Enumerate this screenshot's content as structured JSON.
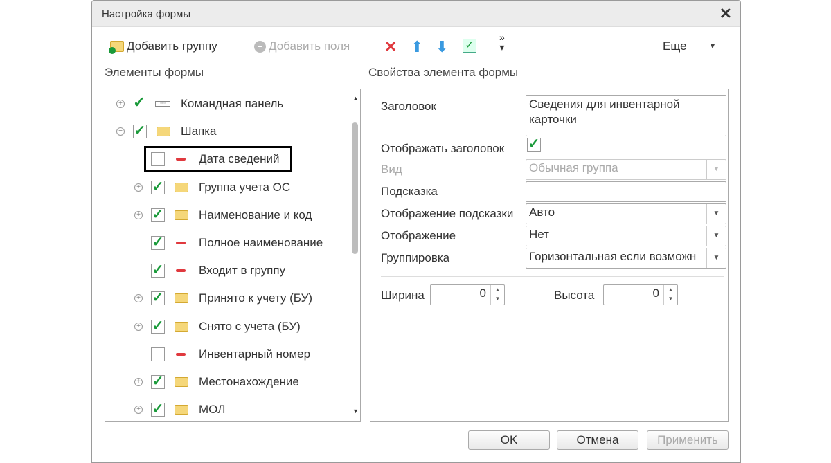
{
  "window": {
    "title": "Настройка формы"
  },
  "toolbar": {
    "add_group": "Добавить группу",
    "add_fields": "Добавить поля",
    "more": "Еще"
  },
  "left": {
    "header": "Элементы формы",
    "items": [
      {
        "label": "Командная панель",
        "level": 0,
        "expander": "+",
        "check": "plain",
        "icon": "command-panel"
      },
      {
        "label": "Шапка",
        "level": 0,
        "expander": "-",
        "check": "checked",
        "icon": "folder"
      },
      {
        "label": "Дата сведений",
        "level": 1,
        "expander": "",
        "check": "unchecked",
        "icon": "field",
        "selected": true
      },
      {
        "label": "Группа учета ОС",
        "level": 1,
        "expander": "+",
        "check": "checked",
        "icon": "folder"
      },
      {
        "label": "Наименование и код",
        "level": 1,
        "expander": "+",
        "check": "checked",
        "icon": "folder"
      },
      {
        "label": "Полное наименование",
        "level": 1,
        "expander": "",
        "check": "checked",
        "icon": "field"
      },
      {
        "label": "Входит в группу",
        "level": 1,
        "expander": "",
        "check": "checked",
        "icon": "field"
      },
      {
        "label": "Принято к учету (БУ)",
        "level": 1,
        "expander": "+",
        "check": "checked",
        "icon": "folder"
      },
      {
        "label": "Снято с учета (БУ)",
        "level": 1,
        "expander": "+",
        "check": "checked",
        "icon": "folder"
      },
      {
        "label": "Инвентарный номер",
        "level": 1,
        "expander": "",
        "check": "unchecked",
        "icon": "field"
      },
      {
        "label": "Местонахождение",
        "level": 1,
        "expander": "+",
        "check": "checked",
        "icon": "folder"
      },
      {
        "label": "МОЛ",
        "level": 1,
        "expander": "+",
        "check": "checked",
        "icon": "folder"
      }
    ]
  },
  "right": {
    "header": "Свойства элемента формы",
    "title_label": "Заголовок",
    "title_value": "Сведения для инвентарной карточки",
    "show_title_label": "Отображать заголовок",
    "view_label": "Вид",
    "view_value": "Обычная группа",
    "hint_label": "Подсказка",
    "hint_value": "",
    "hint_display_label": "Отображение подсказки",
    "hint_display_value": "Авто",
    "display_label": "Отображение",
    "display_value": "Нет",
    "grouping_label": "Группировка",
    "grouping_value": "Горизонтальная если возможн",
    "width_label": "Ширина",
    "width_value": "0",
    "height_label": "Высота",
    "height_value": "0"
  },
  "buttons": {
    "ok": "OK",
    "cancel": "Отмена",
    "apply": "Применить"
  }
}
